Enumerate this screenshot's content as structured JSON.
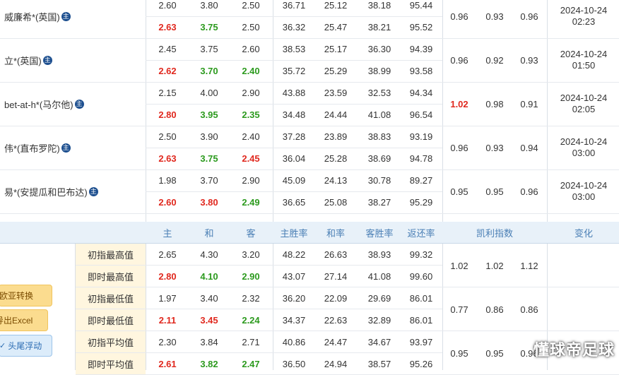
{
  "companies": [
    {
      "name": "威廉希*(英国)",
      "badge": "主",
      "init": [
        "2.60",
        "3.80",
        "2.50",
        "36.71",
        "25.12",
        "38.18",
        "95.44"
      ],
      "live": [
        "2.63",
        "3.75",
        "2.50",
        "36.32",
        "25.47",
        "38.21",
        "95.52"
      ],
      "kelly": [
        "0.96",
        "0.93",
        "0.96"
      ],
      "time": [
        "2024-10-24",
        "02:23"
      ]
    },
    {
      "name": "立*(英国)",
      "badge": "主",
      "init": [
        "2.45",
        "3.75",
        "2.60",
        "38.53",
        "25.17",
        "36.30",
        "94.39"
      ],
      "live": [
        "2.62",
        "3.70",
        "2.40",
        "35.72",
        "25.29",
        "38.99",
        "93.58"
      ],
      "kelly": [
        "0.96",
        "0.92",
        "0.93"
      ],
      "time": [
        "2024-10-24",
        "01:50"
      ]
    },
    {
      "name": "bet-at-h*(马尔他)",
      "badge": "主",
      "init": [
        "2.15",
        "4.00",
        "2.90",
        "43.88",
        "23.59",
        "32.53",
        "94.34"
      ],
      "live": [
        "2.80",
        "3.95",
        "2.35",
        "34.48",
        "24.44",
        "41.08",
        "96.54"
      ],
      "kelly": [
        "1.02",
        "0.98",
        "0.91"
      ],
      "time": [
        "2024-10-24",
        "02:05"
      ]
    },
    {
      "name": "伟*(直布罗陀)",
      "badge": "主",
      "init": [
        "2.50",
        "3.90",
        "2.40",
        "37.28",
        "23.89",
        "38.83",
        "93.19"
      ],
      "live": [
        "2.63",
        "3.75",
        "2.45",
        "36.04",
        "25.28",
        "38.69",
        "94.78"
      ],
      "kelly": [
        "0.96",
        "0.93",
        "0.94"
      ],
      "time": [
        "2024-10-24",
        "03:00"
      ]
    },
    {
      "name": "易*(安提瓜和巴布达)",
      "badge": "主",
      "init": [
        "1.98",
        "3.70",
        "2.90",
        "45.09",
        "24.13",
        "30.78",
        "89.27"
      ],
      "live": [
        "2.60",
        "3.80",
        "2.49",
        "36.65",
        "25.08",
        "38.27",
        "95.29"
      ],
      "kelly": [
        "0.95",
        "0.95",
        "0.96"
      ],
      "time": [
        "2024-10-24",
        "03:00"
      ]
    }
  ],
  "header": [
    "主",
    "和",
    "客",
    "主胜率",
    "和率",
    "客胜率",
    "返还率",
    "凯利指数",
    "变化"
  ],
  "stats": [
    {
      "label": "初指最高值",
      "vals": [
        "2.65",
        "4.30",
        "3.20",
        "48.22",
        "26.63",
        "38.93",
        "99.32"
      ]
    },
    {
      "label": "即时最高值",
      "vals": [
        "2.80",
        "4.10",
        "2.90",
        "43.07",
        "27.14",
        "41.08",
        "99.60"
      ]
    },
    {
      "label": "初指最低值",
      "vals": [
        "1.97",
        "3.40",
        "2.32",
        "36.20",
        "22.09",
        "29.69",
        "86.01"
      ]
    },
    {
      "label": "即时最低值",
      "vals": [
        "2.11",
        "3.45",
        "2.24",
        "34.37",
        "22.63",
        "32.89",
        "86.01"
      ]
    },
    {
      "label": "初指平均值",
      "vals": [
        "2.30",
        "3.84",
        "2.71",
        "40.86",
        "24.47",
        "34.67",
        "93.97"
      ]
    },
    {
      "label": "即时平均值",
      "vals": [
        "2.61",
        "3.82",
        "2.47",
        "36.50",
        "24.94",
        "38.57",
        "95.26"
      ]
    }
  ],
  "stat_kelly": [
    [
      "1.02",
      "1.02",
      "1.12"
    ],
    [
      "0.77",
      "0.86",
      "0.86"
    ],
    [
      "0.95",
      "0.95",
      "0.96"
    ]
  ],
  "buttons": {
    "convert": "欧亚转换",
    "export": "导出Excel",
    "float": "头尾浮动"
  },
  "watermark": "懂球帝足球",
  "colors": {
    "red": "#e0281e",
    "green": "#2c9a1e",
    "header_bg": "#e8f1f9"
  }
}
